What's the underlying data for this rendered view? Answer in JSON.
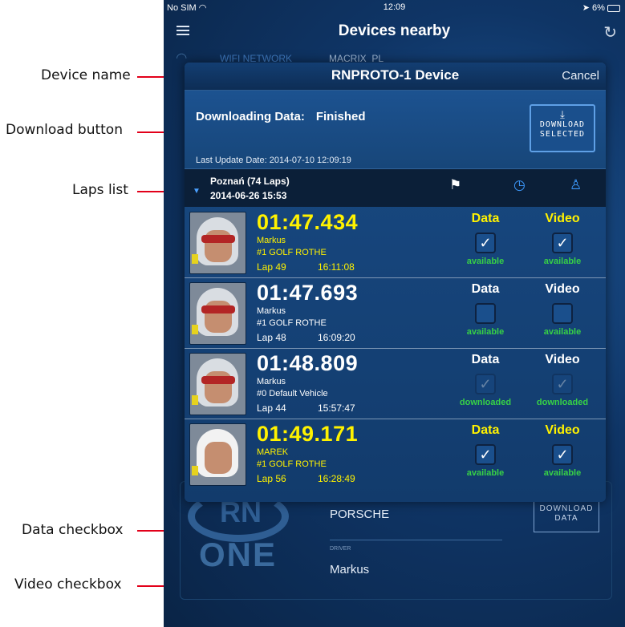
{
  "callouts": {
    "device_name": "Device name",
    "download_button": "Download button",
    "laps_list": "Laps list",
    "data_checkbox": "Data checkbox",
    "video_checkbox": "Video checkbox"
  },
  "status_bar": {
    "carrier": "No SIM",
    "time": "12:09",
    "battery": "6%"
  },
  "nav": {
    "title": "Devices nearby",
    "menu_icon": "hamburger-icon",
    "refresh_icon": "refresh-icon"
  },
  "background": {
    "wifi_label": "WIFI NETWORK",
    "wifi_value": "MACRIX_PL",
    "vehicle_value": "PORSCHE",
    "driver_label": "DRIVER",
    "driver_value": "Markus",
    "download_data_label": "DOWNLOAD DATA",
    "logo_top": "RN",
    "logo_bottom": "ONE"
  },
  "modal": {
    "device_name": "RNPROTO-1 Device",
    "cancel_label": "Cancel",
    "downloading_label": "Downloading Data:",
    "downloading_status": "Finished",
    "last_update": "Last Update Date: 2014-07-10 12:09:19",
    "download_button": {
      "line1": "DOWNLOAD",
      "line2": "SELECTED"
    },
    "section": {
      "name": "Poznań (74 Laps)",
      "date": "2014-06-26 15:53"
    },
    "column_data": "Data",
    "column_video": "Video"
  },
  "laps": [
    {
      "time": "01:47.434",
      "driver": "Markus",
      "vehicle": "#1 GOLF ROTHE",
      "lap": "Lap 49",
      "lap_time": "16:11:08",
      "highlight": true,
      "data_checked": true,
      "video_checked": true,
      "data_status": "available",
      "video_status": "available"
    },
    {
      "time": "01:47.693",
      "driver": "Markus",
      "vehicle": "#1 GOLF ROTHE",
      "lap": "Lap 48",
      "lap_time": "16:09:20",
      "highlight": false,
      "data_checked": false,
      "video_checked": false,
      "data_status": "available",
      "video_status": "available"
    },
    {
      "time": "01:48.809",
      "driver": "Markus",
      "vehicle": "#0 Default Vehicle",
      "lap": "Lap 44",
      "lap_time": "15:57:47",
      "highlight": false,
      "data_checked": "dim",
      "video_checked": "dim",
      "data_status": "downloaded",
      "video_status": "downloaded"
    },
    {
      "time": "01:49.171",
      "driver": "MAREK",
      "vehicle": "#1 GOLF ROTHE",
      "lap": "Lap 56",
      "lap_time": "16:28:49",
      "highlight": true,
      "data_checked": true,
      "video_checked": true,
      "data_status": "available",
      "video_status": "available"
    }
  ]
}
